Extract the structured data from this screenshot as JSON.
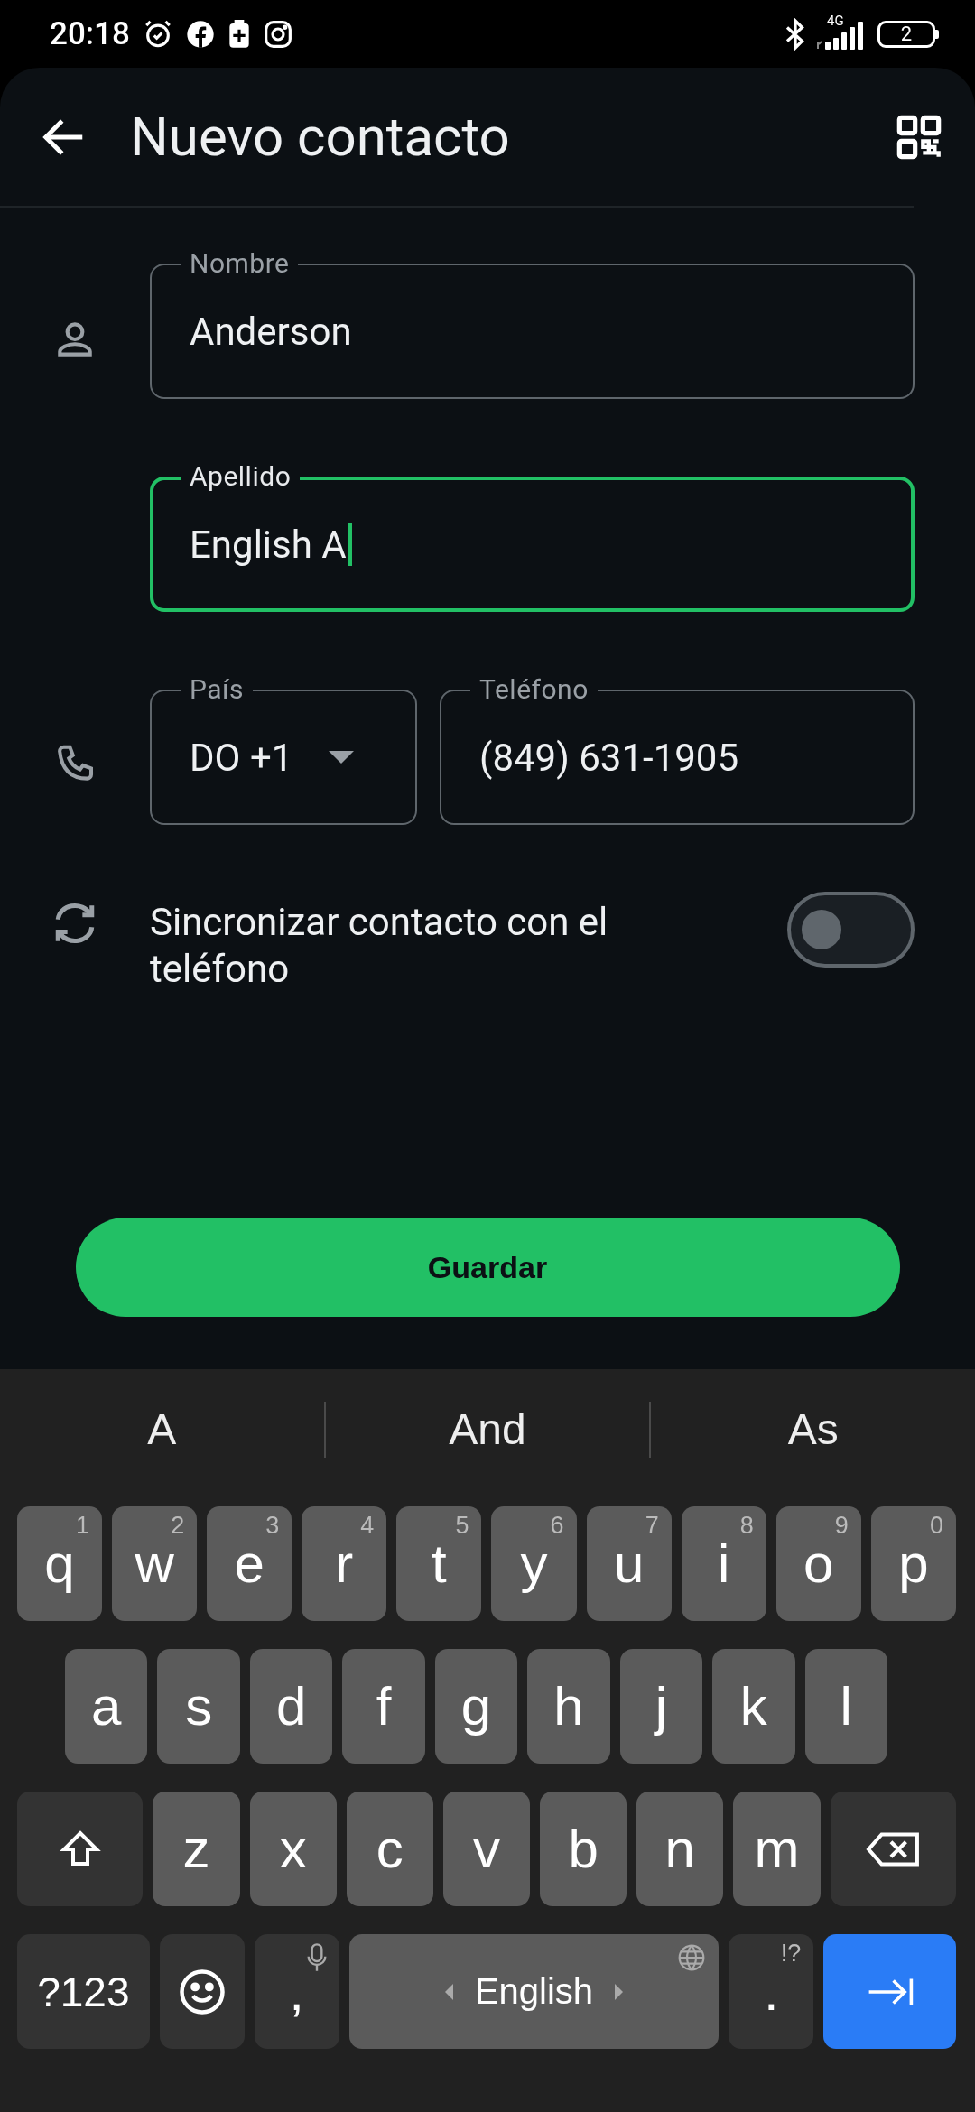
{
  "status_bar": {
    "time": "20:18",
    "network": "4G",
    "battery": "2"
  },
  "header": {
    "title": "Nuevo contacto"
  },
  "fields": [
    {
      "label": "Nombre",
      "value": "Anderson",
      "focused": false
    },
    {
      "label": "Apellido",
      "value": "English A",
      "focused": true
    }
  ],
  "phone_row": {
    "country": {
      "label": "País",
      "value": "DO +1"
    },
    "phone": {
      "label": "Teléfono",
      "value": "(849) 631-1905",
      "focused": false
    }
  },
  "sync": {
    "label": "Sincronizar contacto con el teléfono",
    "on": false
  },
  "save_button": "Guardar",
  "keyboard": {
    "suggestions": [
      "A",
      "And",
      "As"
    ],
    "rows": [
      {
        "keys": [
          {
            "kind": "letter",
            "label": "q",
            "hint": "1"
          },
          {
            "kind": "letter",
            "label": "w",
            "hint": "2"
          },
          {
            "kind": "letter",
            "label": "e",
            "hint": "3"
          },
          {
            "kind": "letter",
            "label": "r",
            "hint": "4"
          },
          {
            "kind": "letter",
            "label": "t",
            "hint": "5"
          },
          {
            "kind": "letter",
            "label": "y",
            "hint": "6"
          },
          {
            "kind": "letter",
            "label": "u",
            "hint": "7"
          },
          {
            "kind": "letter",
            "label": "i",
            "hint": "8"
          },
          {
            "kind": "letter",
            "label": "o",
            "hint": "9"
          },
          {
            "kind": "letter",
            "label": "p",
            "hint": "0"
          }
        ]
      },
      {
        "keys": [
          {
            "kind": "letter",
            "label": "a"
          },
          {
            "kind": "letter",
            "label": "s"
          },
          {
            "kind": "letter",
            "label": "d"
          },
          {
            "kind": "letter",
            "label": "f"
          },
          {
            "kind": "letter",
            "label": "g"
          },
          {
            "kind": "letter",
            "label": "h"
          },
          {
            "kind": "letter",
            "label": "j"
          },
          {
            "kind": "letter",
            "label": "k"
          },
          {
            "kind": "letter",
            "label": "l"
          }
        ]
      },
      {
        "keys": [
          {
            "kind": "shift"
          },
          {
            "kind": "letter",
            "label": "z"
          },
          {
            "kind": "letter",
            "label": "x"
          },
          {
            "kind": "letter",
            "label": "c"
          },
          {
            "kind": "letter",
            "label": "v"
          },
          {
            "kind": "letter",
            "label": "b"
          },
          {
            "kind": "letter",
            "label": "n"
          },
          {
            "kind": "letter",
            "label": "m"
          },
          {
            "kind": "backspace"
          }
        ]
      },
      {
        "keys": [
          {
            "kind": "symbols",
            "label": "?123"
          },
          {
            "kind": "emoji"
          },
          {
            "kind": "comma",
            "label": ","
          },
          {
            "kind": "space",
            "label": "English"
          },
          {
            "kind": "period",
            "label": ".",
            "hint": "!?"
          },
          {
            "kind": "enter"
          }
        ]
      }
    ]
  }
}
